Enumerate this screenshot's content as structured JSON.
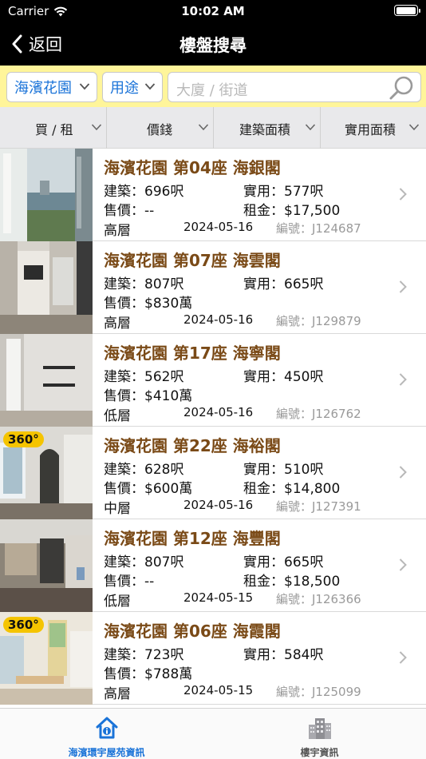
{
  "status_bar": {
    "carrier": "Carrier",
    "time": "10:02 AM"
  },
  "nav": {
    "back_label": "返回",
    "title": "樓盤搜尋"
  },
  "search": {
    "estate": "海濱花園",
    "usage": "用途",
    "placeholder": "大廈 / 街道"
  },
  "sort_tabs": [
    {
      "label": "買 / 租"
    },
    {
      "label": "價錢"
    },
    {
      "label": "建築面積"
    },
    {
      "label": "實用面積"
    }
  ],
  "listings": [
    {
      "title": "海濱花園 第04座 海銀閣",
      "gross": "建築：696呎",
      "saleable": "實用：577呎",
      "price": "售價：--",
      "rent": "租金：$17,500",
      "floor": "高層",
      "date": "2024-05-16",
      "code": "編號：J124687",
      "badge": ""
    },
    {
      "title": "海濱花園 第07座 海雲閣",
      "gross": "建築：807呎",
      "saleable": "實用：665呎",
      "price": "售價：$830萬",
      "rent": "",
      "floor": "高層",
      "date": "2024-05-16",
      "code": "編號：J129879",
      "badge": ""
    },
    {
      "title": "海濱花園 第17座 海寧閣",
      "gross": "建築：562呎",
      "saleable": "實用：450呎",
      "price": "售價：$410萬",
      "rent": "",
      "floor": "低層",
      "date": "2024-05-16",
      "code": "編號：J126762",
      "badge": ""
    },
    {
      "title": "海濱花園 第22座 海裕閣",
      "gross": "建築：628呎",
      "saleable": "實用：510呎",
      "price": "售價：$600萬",
      "rent": "租金：$14,800",
      "floor": "中層",
      "date": "2024-05-16",
      "code": "編號：J127391",
      "badge": "360°"
    },
    {
      "title": "海濱花園 第12座 海豐閣",
      "gross": "建築：807呎",
      "saleable": "實用：665呎",
      "price": "售價：--",
      "rent": "租金：$18,500",
      "floor": "低層",
      "date": "2024-05-15",
      "code": "編號：J126366",
      "badge": ""
    },
    {
      "title": "海濱花園 第06座 海霞閣",
      "gross": "建築：723呎",
      "saleable": "實用：584呎",
      "price": "售價：$788萬",
      "rent": "",
      "floor": "高層",
      "date": "2024-05-15",
      "code": "編號：J125099",
      "badge": "360°"
    }
  ],
  "tabs": [
    {
      "label": "海濱環宇屋苑資訊",
      "icon": "house-info-icon",
      "active": true
    },
    {
      "label": "樓宇資訊",
      "icon": "buildings-icon",
      "active": false
    }
  ],
  "colors": {
    "header": "#000000",
    "search_bg": "#fff59a",
    "title_brown": "#7a4a17",
    "accent_blue": "#1a73d8"
  }
}
